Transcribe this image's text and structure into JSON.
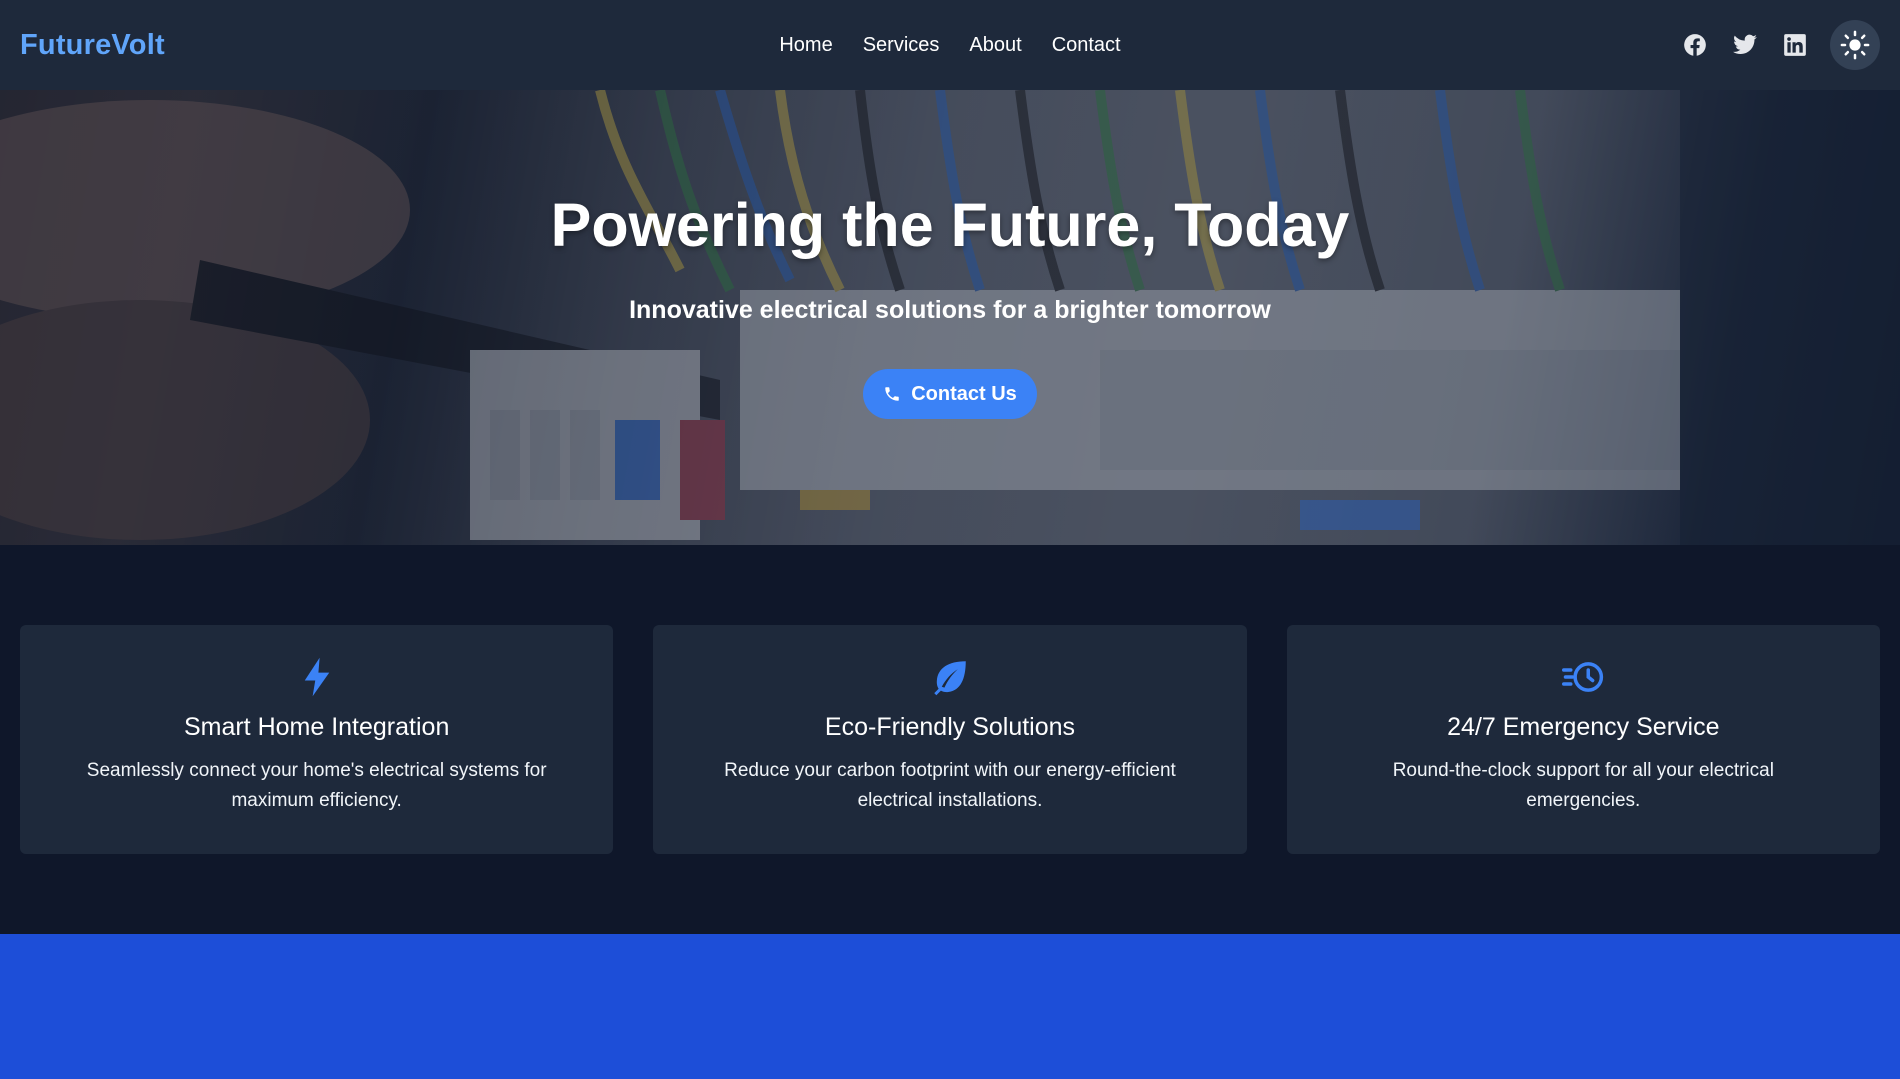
{
  "nav": {
    "brand": "FutureVolt",
    "links": [
      {
        "label": "Home"
      },
      {
        "label": "Services"
      },
      {
        "label": "About"
      },
      {
        "label": "Contact"
      }
    ],
    "social": [
      "facebook-icon",
      "twitter-icon",
      "linkedin-icon"
    ],
    "theme_icon": "sun-icon"
  },
  "hero": {
    "title": "Powering the Future, Today",
    "subtitle": "Innovative electrical solutions for a brighter tomorrow",
    "cta_label": "Contact Us",
    "cta_icon": "phone-icon"
  },
  "features": [
    {
      "icon": "lightning-bolt-icon",
      "title": "Smart Home Integration",
      "description": "Seamlessly connect your home's electrical systems for maximum efficiency."
    },
    {
      "icon": "leaf-icon",
      "title": "Eco-Friendly Solutions",
      "description": "Reduce your carbon footprint with our energy-efficient electrical installations."
    },
    {
      "icon": "clock-fast-icon",
      "title": "24/7 Emergency Service",
      "description": "Round-the-clock support for all your electrical emergencies."
    }
  ],
  "colors": {
    "brand": "#60a5fa",
    "accent": "#3b82f6",
    "nav_bg": "#1e293b",
    "page_bg": "#0f172a",
    "card_bg": "#1e293b",
    "bottom_band": "#1d4ed8"
  }
}
